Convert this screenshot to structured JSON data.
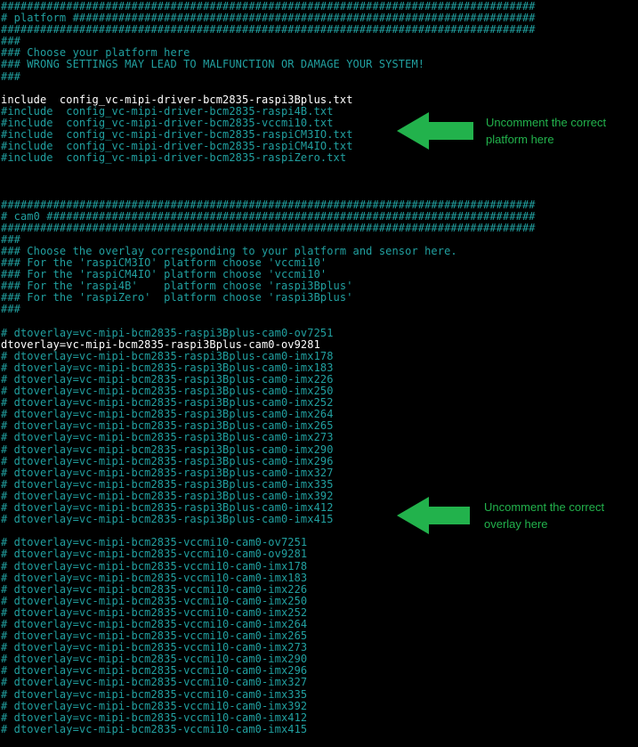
{
  "colors": {
    "background": "#000000",
    "comment_text": "#21a0a0",
    "active_text": "#ffffff",
    "annotation_green": "#22b24c"
  },
  "lines": [
    {
      "text": "##################################################################################",
      "active": false
    },
    {
      "text": "# platform #######################################################################",
      "active": false
    },
    {
      "text": "##################################################################################",
      "active": false
    },
    {
      "text": "###",
      "active": false
    },
    {
      "text": "### Choose your platform here",
      "active": false
    },
    {
      "text": "### WRONG SETTINGS MAY LEAD TO MALFUNCTION OR DAMAGE YOUR SYSTEM!",
      "active": false
    },
    {
      "text": "###",
      "active": false
    },
    {
      "text": "",
      "active": false
    },
    {
      "text": "include  config_vc-mipi-driver-bcm2835-raspi3Bplus.txt",
      "active": true
    },
    {
      "text": "#include  config_vc-mipi-driver-bcm2835-raspi4B.txt",
      "active": false
    },
    {
      "text": "#include  config_vc-mipi-driver-bcm2835-vccmi10.txt",
      "active": false
    },
    {
      "text": "#include  config_vc-mipi-driver-bcm2835-raspiCM3IO.txt",
      "active": false
    },
    {
      "text": "#include  config_vc-mipi-driver-bcm2835-raspiCM4IO.txt",
      "active": false
    },
    {
      "text": "#include  config_vc-mipi-driver-bcm2835-raspiZero.txt",
      "active": false
    },
    {
      "text": "",
      "active": false
    },
    {
      "text": "",
      "active": false
    },
    {
      "text": "",
      "active": false
    },
    {
      "text": "##################################################################################",
      "active": false
    },
    {
      "text": "# cam0 ###########################################################################",
      "active": false
    },
    {
      "text": "##################################################################################",
      "active": false
    },
    {
      "text": "###",
      "active": false
    },
    {
      "text": "### Choose the overlay corresponding to your platform and sensor here.",
      "active": false
    },
    {
      "text": "### For the 'raspiCM3IO' platform choose 'vccmi10'",
      "active": false
    },
    {
      "text": "### For the 'raspiCM4IO' platform choose 'vccmi10'",
      "active": false
    },
    {
      "text": "### For the 'raspi4B'    platform choose 'raspi3Bplus'",
      "active": false
    },
    {
      "text": "### For the 'raspiZero'  platform choose 'raspi3Bplus'",
      "active": false
    },
    {
      "text": "###",
      "active": false
    },
    {
      "text": "",
      "active": false
    },
    {
      "text": "# dtoverlay=vc-mipi-bcm2835-raspi3Bplus-cam0-ov7251",
      "active": false
    },
    {
      "text": "dtoverlay=vc-mipi-bcm2835-raspi3Bplus-cam0-ov9281",
      "active": true
    },
    {
      "text": "# dtoverlay=vc-mipi-bcm2835-raspi3Bplus-cam0-imx178",
      "active": false
    },
    {
      "text": "# dtoverlay=vc-mipi-bcm2835-raspi3Bplus-cam0-imx183",
      "active": false
    },
    {
      "text": "# dtoverlay=vc-mipi-bcm2835-raspi3Bplus-cam0-imx226",
      "active": false
    },
    {
      "text": "# dtoverlay=vc-mipi-bcm2835-raspi3Bplus-cam0-imx250",
      "active": false
    },
    {
      "text": "# dtoverlay=vc-mipi-bcm2835-raspi3Bplus-cam0-imx252",
      "active": false
    },
    {
      "text": "# dtoverlay=vc-mipi-bcm2835-raspi3Bplus-cam0-imx264",
      "active": false
    },
    {
      "text": "# dtoverlay=vc-mipi-bcm2835-raspi3Bplus-cam0-imx265",
      "active": false
    },
    {
      "text": "# dtoverlay=vc-mipi-bcm2835-raspi3Bplus-cam0-imx273",
      "active": false
    },
    {
      "text": "# dtoverlay=vc-mipi-bcm2835-raspi3Bplus-cam0-imx290",
      "active": false
    },
    {
      "text": "# dtoverlay=vc-mipi-bcm2835-raspi3Bplus-cam0-imx296",
      "active": false
    },
    {
      "text": "# dtoverlay=vc-mipi-bcm2835-raspi3Bplus-cam0-imx327",
      "active": false
    },
    {
      "text": "# dtoverlay=vc-mipi-bcm2835-raspi3Bplus-cam0-imx335",
      "active": false
    },
    {
      "text": "# dtoverlay=vc-mipi-bcm2835-raspi3Bplus-cam0-imx392",
      "active": false
    },
    {
      "text": "# dtoverlay=vc-mipi-bcm2835-raspi3Bplus-cam0-imx412",
      "active": false
    },
    {
      "text": "# dtoverlay=vc-mipi-bcm2835-raspi3Bplus-cam0-imx415",
      "active": false
    },
    {
      "text": "",
      "active": false
    },
    {
      "text": "# dtoverlay=vc-mipi-bcm2835-vccmi10-cam0-ov7251",
      "active": false
    },
    {
      "text": "# dtoverlay=vc-mipi-bcm2835-vccmi10-cam0-ov9281",
      "active": false
    },
    {
      "text": "# dtoverlay=vc-mipi-bcm2835-vccmi10-cam0-imx178",
      "active": false
    },
    {
      "text": "# dtoverlay=vc-mipi-bcm2835-vccmi10-cam0-imx183",
      "active": false
    },
    {
      "text": "# dtoverlay=vc-mipi-bcm2835-vccmi10-cam0-imx226",
      "active": false
    },
    {
      "text": "# dtoverlay=vc-mipi-bcm2835-vccmi10-cam0-imx250",
      "active": false
    },
    {
      "text": "# dtoverlay=vc-mipi-bcm2835-vccmi10-cam0-imx252",
      "active": false
    },
    {
      "text": "# dtoverlay=vc-mipi-bcm2835-vccmi10-cam0-imx264",
      "active": false
    },
    {
      "text": "# dtoverlay=vc-mipi-bcm2835-vccmi10-cam0-imx265",
      "active": false
    },
    {
      "text": "# dtoverlay=vc-mipi-bcm2835-vccmi10-cam0-imx273",
      "active": false
    },
    {
      "text": "# dtoverlay=vc-mipi-bcm2835-vccmi10-cam0-imx290",
      "active": false
    },
    {
      "text": "# dtoverlay=vc-mipi-bcm2835-vccmi10-cam0-imx296",
      "active": false
    },
    {
      "text": "# dtoverlay=vc-mipi-bcm2835-vccmi10-cam0-imx327",
      "active": false
    },
    {
      "text": "# dtoverlay=vc-mipi-bcm2835-vccmi10-cam0-imx335",
      "active": false
    },
    {
      "text": "# dtoverlay=vc-mipi-bcm2835-vccmi10-cam0-imx392",
      "active": false
    },
    {
      "text": "# dtoverlay=vc-mipi-bcm2835-vccmi10-cam0-imx412",
      "active": false
    },
    {
      "text": "# dtoverlay=vc-mipi-bcm2835-vccmi10-cam0-imx415",
      "active": false
    }
  ],
  "annotations": {
    "platform": {
      "line1": "Uncomment the correct",
      "line2": "platform here",
      "icon": "left-arrow-icon"
    },
    "overlay": {
      "line1": "Uncomment the correct",
      "line2": "overlay here",
      "icon": "left-arrow-icon"
    }
  }
}
